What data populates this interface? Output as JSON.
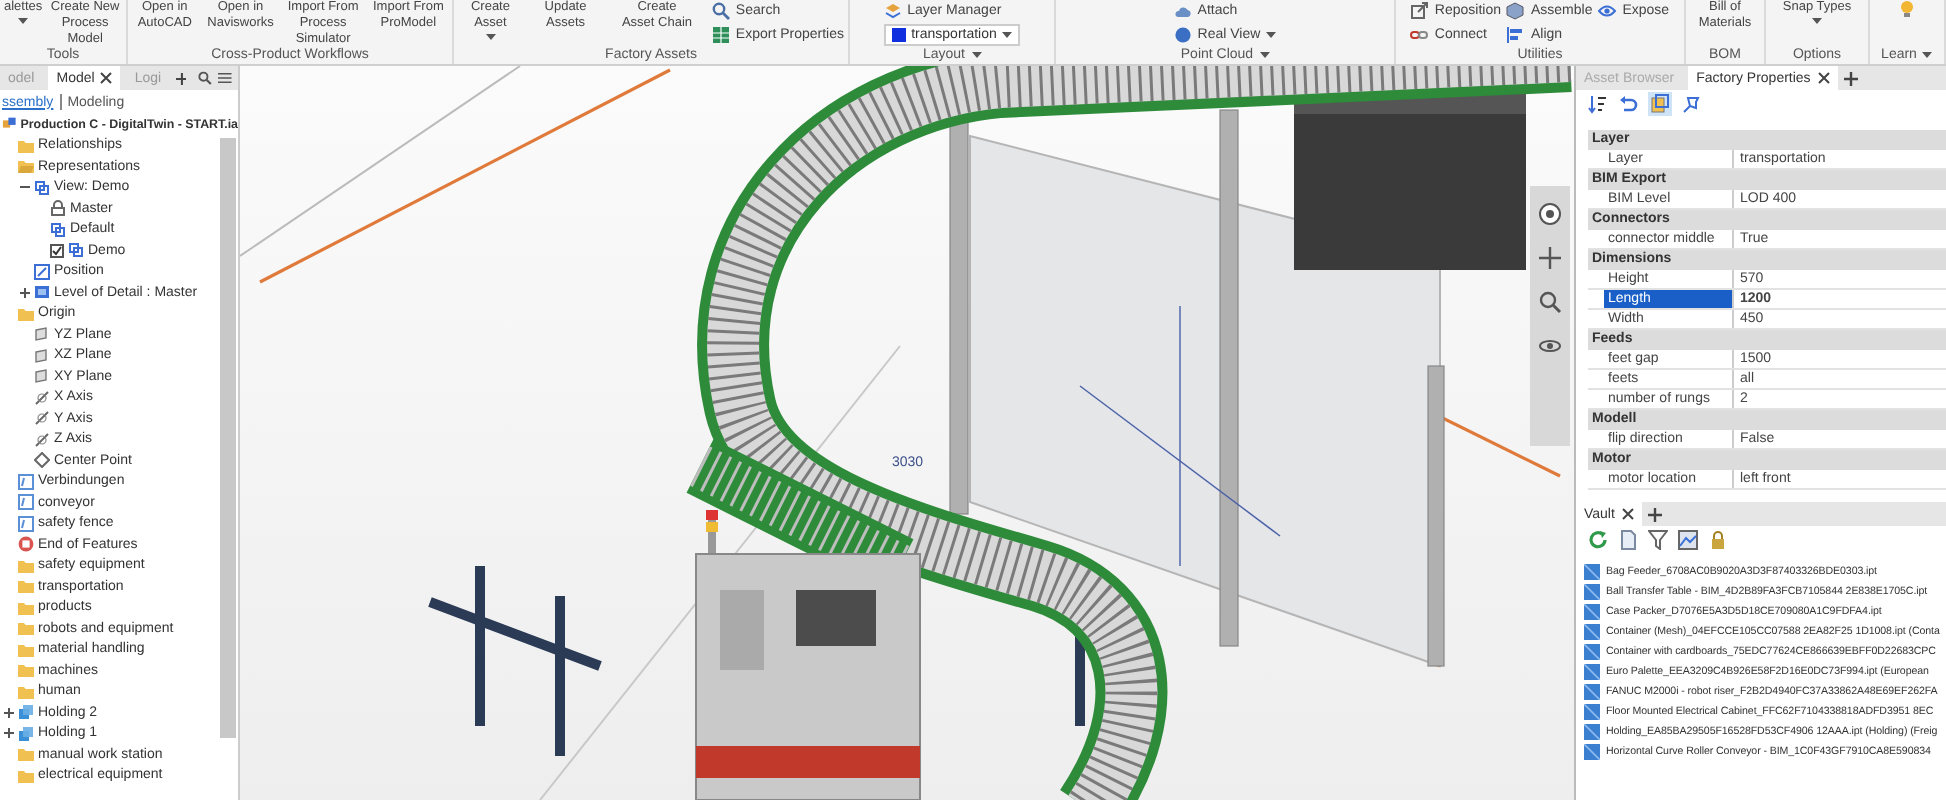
{
  "ribbon": {
    "groups": [
      {
        "label": "Tools",
        "caret": false,
        "columns": [
          [
            {
              "label": "alettes",
              "kind": "large",
              "caret": true
            }
          ],
          [
            {
              "label": "Create New Process Model",
              "kind": "large",
              "caret": false
            }
          ]
        ]
      },
      {
        "label": "Cross-Product Workflows",
        "caret": false,
        "columns": [
          [
            {
              "label": "Open in AutoCAD",
              "kind": "large",
              "caret": false
            }
          ],
          [
            {
              "label": "Open in Navisworks",
              "kind": "large",
              "caret": false
            }
          ],
          [
            {
              "label": "Import From Process Simulator",
              "kind": "large",
              "caret": false
            }
          ],
          [
            {
              "label": "Import From ProModel",
              "kind": "large",
              "caret": false
            }
          ]
        ]
      },
      {
        "label": "Factory Assets",
        "caret": false,
        "columns": [
          [
            {
              "label": "Create Asset",
              "kind": "large",
              "caret": true
            }
          ],
          [
            {
              "label": "Update Assets",
              "kind": "large",
              "caret": false
            }
          ],
          [
            {
              "label": "Create Asset Chain",
              "kind": "large",
              "caret": false
            }
          ],
          [
            {
              "label": "Search",
              "kind": "small",
              "caret": false
            },
            {
              "label": "Export Properties",
              "kind": "small",
              "caret": false
            }
          ]
        ]
      },
      {
        "label": "Layout",
        "caret": true,
        "columns": [
          [
            {
              "label": "Layer Manager",
              "kind": "small",
              "caret": false
            },
            {
              "label": "transportation",
              "kind": "dropdown",
              "caret": true
            }
          ]
        ]
      },
      {
        "label": "Point Cloud",
        "caret": true,
        "columns": [
          [
            {
              "label": "Attach",
              "kind": "small",
              "caret": false
            },
            {
              "label": "Real View",
              "kind": "small",
              "caret": true
            }
          ]
        ]
      },
      {
        "label": "Utilities",
        "caret": false,
        "columns": [
          [
            {
              "label": "Reposition",
              "kind": "small",
              "caret": false
            },
            {
              "label": "Connect",
              "kind": "small",
              "caret": false
            }
          ],
          [
            {
              "label": "Assemble",
              "kind": "small",
              "caret": false
            },
            {
              "label": "Align",
              "kind": "small",
              "caret": false
            }
          ],
          [
            {
              "label": "Expose",
              "kind": "small",
              "caret": false
            }
          ]
        ]
      },
      {
        "label": "BOM",
        "caret": false,
        "columns": [
          [
            {
              "label": "Bill of Materials",
              "kind": "large",
              "caret": false
            }
          ]
        ]
      },
      {
        "label": "Options",
        "caret": false,
        "columns": [
          [
            {
              "label": "Snap Types",
              "kind": "large",
              "caret": true
            }
          ]
        ]
      },
      {
        "label": "Learn",
        "caret": true
      }
    ]
  },
  "browser": {
    "tabs": [
      {
        "label": "odel",
        "selected": false,
        "closable": false
      },
      {
        "label": "Model",
        "selected": true,
        "closable": true
      },
      {
        "label": "Logi",
        "selected": false,
        "closable": false
      }
    ],
    "modes": [
      {
        "label": "ssembly",
        "selected": true
      },
      {
        "label": "Modeling",
        "selected": false
      }
    ],
    "root": "Production C - DigitalTwin - START.ia",
    "items": [
      {
        "label": "Relationships",
        "kind": "folder"
      },
      {
        "label": "Representations",
        "kind": "folder-open",
        "children": [
          {
            "label": "View: Demo",
            "kind": "view",
            "expanded": true,
            "children": [
              {
                "label": "Master",
                "kind": "lock"
              },
              {
                "label": "Default",
                "kind": "view"
              },
              {
                "label": "Demo",
                "kind": "view",
                "checked": true
              }
            ]
          },
          {
            "label": "Position",
            "kind": "position"
          },
          {
            "label": "Level of Detail : Master",
            "kind": "lod",
            "expanded": false
          }
        ]
      },
      {
        "label": "Origin",
        "kind": "folder",
        "children": [
          {
            "label": "YZ Plane",
            "kind": "plane"
          },
          {
            "label": "XZ Plane",
            "kind": "plane"
          },
          {
            "label": "XY Plane",
            "kind": "plane"
          },
          {
            "label": "X Axis",
            "kind": "axis"
          },
          {
            "label": "Y Axis",
            "kind": "axis"
          },
          {
            "label": "Z Axis",
            "kind": "axis"
          },
          {
            "label": "Center Point",
            "kind": "point"
          }
        ]
      },
      {
        "label": "Verbindungen",
        "kind": "sketch"
      },
      {
        "label": "conveyor",
        "kind": "sketch"
      },
      {
        "label": "safety fence",
        "kind": "sketch"
      },
      {
        "label": "End of Features",
        "kind": "end"
      },
      {
        "label": "safety equipment",
        "kind": "folder"
      },
      {
        "label": "transportation",
        "kind": "folder"
      },
      {
        "label": "products",
        "kind": "folder"
      },
      {
        "label": "robots and equipment",
        "kind": "folder"
      },
      {
        "label": "material handling",
        "kind": "folder"
      },
      {
        "label": "machines",
        "kind": "folder"
      },
      {
        "label": "human",
        "kind": "folder"
      },
      {
        "label": "Holding 2",
        "kind": "assembly",
        "expanded": false
      },
      {
        "label": "Holding 1",
        "kind": "assembly",
        "expanded": false
      },
      {
        "label": "manual work station",
        "kind": "folder"
      },
      {
        "label": "electrical equipment",
        "kind": "folder"
      }
    ]
  },
  "viewport": {
    "dimension": "3030"
  },
  "properties": {
    "tabs": [
      {
        "label": "Asset Browser",
        "selected": false,
        "closable": false
      },
      {
        "label": "Factory Properties",
        "selected": true,
        "closable": true
      }
    ],
    "groups": [
      {
        "title": "Layer",
        "rows": [
          {
            "name": "Layer",
            "value": "transportation",
            "selected": false
          }
        ]
      },
      {
        "title": "BIM Export",
        "rows": [
          {
            "name": "BIM Level",
            "value": "LOD 400",
            "selected": false
          }
        ]
      },
      {
        "title": "Connectors",
        "rows": [
          {
            "name": "connector middle",
            "value": "True",
            "selected": false
          }
        ]
      },
      {
        "title": "Dimensions",
        "rows": [
          {
            "name": "Height",
            "value": "570",
            "selected": false
          },
          {
            "name": "Length",
            "value": "1200",
            "selected": true
          },
          {
            "name": "Width",
            "value": "450",
            "selected": false
          }
        ]
      },
      {
        "title": "Feeds",
        "rows": [
          {
            "name": "feet gap",
            "value": "1500",
            "selected": false
          },
          {
            "name": "feets",
            "value": "all",
            "selected": false
          },
          {
            "name": "number of rungs",
            "value": "2",
            "selected": false
          }
        ]
      },
      {
        "title": "Modell",
        "rows": [
          {
            "name": "flip direction",
            "value": "False",
            "selected": false
          }
        ]
      },
      {
        "title": "Motor",
        "rows": [
          {
            "name": "motor location",
            "value": "left front",
            "selected": false
          }
        ]
      }
    ]
  },
  "vault": {
    "tab": "Vault",
    "files": [
      "Bag Feeder_6708AC0B9020A3D3F87403326BDE0303.ipt",
      "Ball Transfer Table - BIM_4D2B89FA3FCB7105844 2E838E1705C.ipt",
      "Case Packer_D7076E5A3D5D18CE709080A1C9FDFA4.ipt",
      "Container (Mesh)_04EFCCE105CC07588 2EA82F25 1D1008.ipt (Conta",
      "Container with cardboards_75EDC77624CE866639EBFF0D22683CPC",
      "Euro Palette_EEA3209C4B926E58F2D16E0DC73F994.ipt (European",
      "FANUC M2000i - robot riser_F2B2D4940FC37A33862A48E69EF262FA",
      "Floor Mounted Electrical Cabinet_FFC62F7104338818ADFD3951 8EC",
      "Holding_EA85BA29505F16528FD53CF4906 12AAA.ipt (Holding) (Freig",
      "Horizontal Curve Roller Conveyor - BIM_1C0F43GF7910CA8E590834"
    ]
  }
}
